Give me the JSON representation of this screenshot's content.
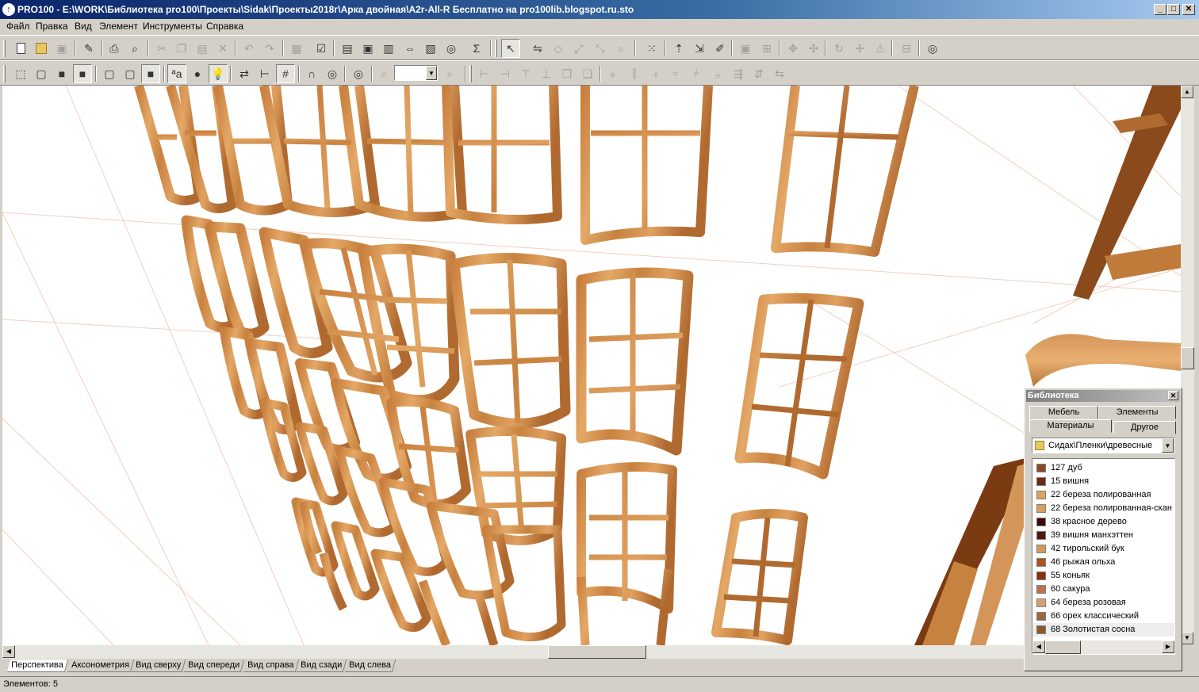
{
  "window": {
    "title": "PRO100 - E:\\WORK\\Библиотека pro100\\Проекты\\Sidak\\Проекты2018г\\Арка двойная\\A2r-All-R Бесплатно на pro100lib.blogspot.ru.sto",
    "minimize": "_",
    "maximize": "□",
    "close": "✕"
  },
  "menu": [
    "Файл",
    "Правка",
    "Вид",
    "Элемент",
    "Инструменты",
    "Справка"
  ],
  "toolbar2": {
    "zoom_value": ""
  },
  "view_tabs": [
    "Перспектива",
    "Аксонометрия",
    "Вид сверху",
    "Вид спереди",
    "Вид справа",
    "Вид сзади",
    "Вид слева"
  ],
  "status": {
    "text": "Элементов: 5"
  },
  "library": {
    "title": "Библиотека",
    "close": "✕",
    "tabs_top": [
      "Мебель",
      "Элементы"
    ],
    "tabs_bottom": [
      "Материалы",
      "Другое"
    ],
    "path": "Сидак\\Пленки\\древесные",
    "items": [
      {
        "label": "127 дуб",
        "color": "#8b4a22"
      },
      {
        "label": "15 вишня",
        "color": "#6b2a12"
      },
      {
        "label": "22 береза полированная",
        "color": "#d9a55a"
      },
      {
        "label": "22 береза полированная-скан",
        "color": "#d4a060"
      },
      {
        "label": "38 красное дерево",
        "color": "#3a0a06"
      },
      {
        "label": "39 вишня манхэттен",
        "color": "#4a1a0a"
      },
      {
        "label": "42 тирольский бук",
        "color": "#d49a5a"
      },
      {
        "label": "46 рыжая ольха",
        "color": "#b0501a"
      },
      {
        "label": "55 коньяк",
        "color": "#8a3010"
      },
      {
        "label": "60 сакура",
        "color": "#c07050"
      },
      {
        "label": "64 береза розовая",
        "color": "#d8a070"
      },
      {
        "label": "66 орех классический",
        "color": "#9a6a40"
      },
      {
        "label": "68 Золотистая сосна",
        "color": "#8a5a2a"
      }
    ]
  },
  "colors": {
    "wood_light": "#d8995a",
    "wood_dark": "#a4612c",
    "grid_line": "#f0c8b8"
  }
}
